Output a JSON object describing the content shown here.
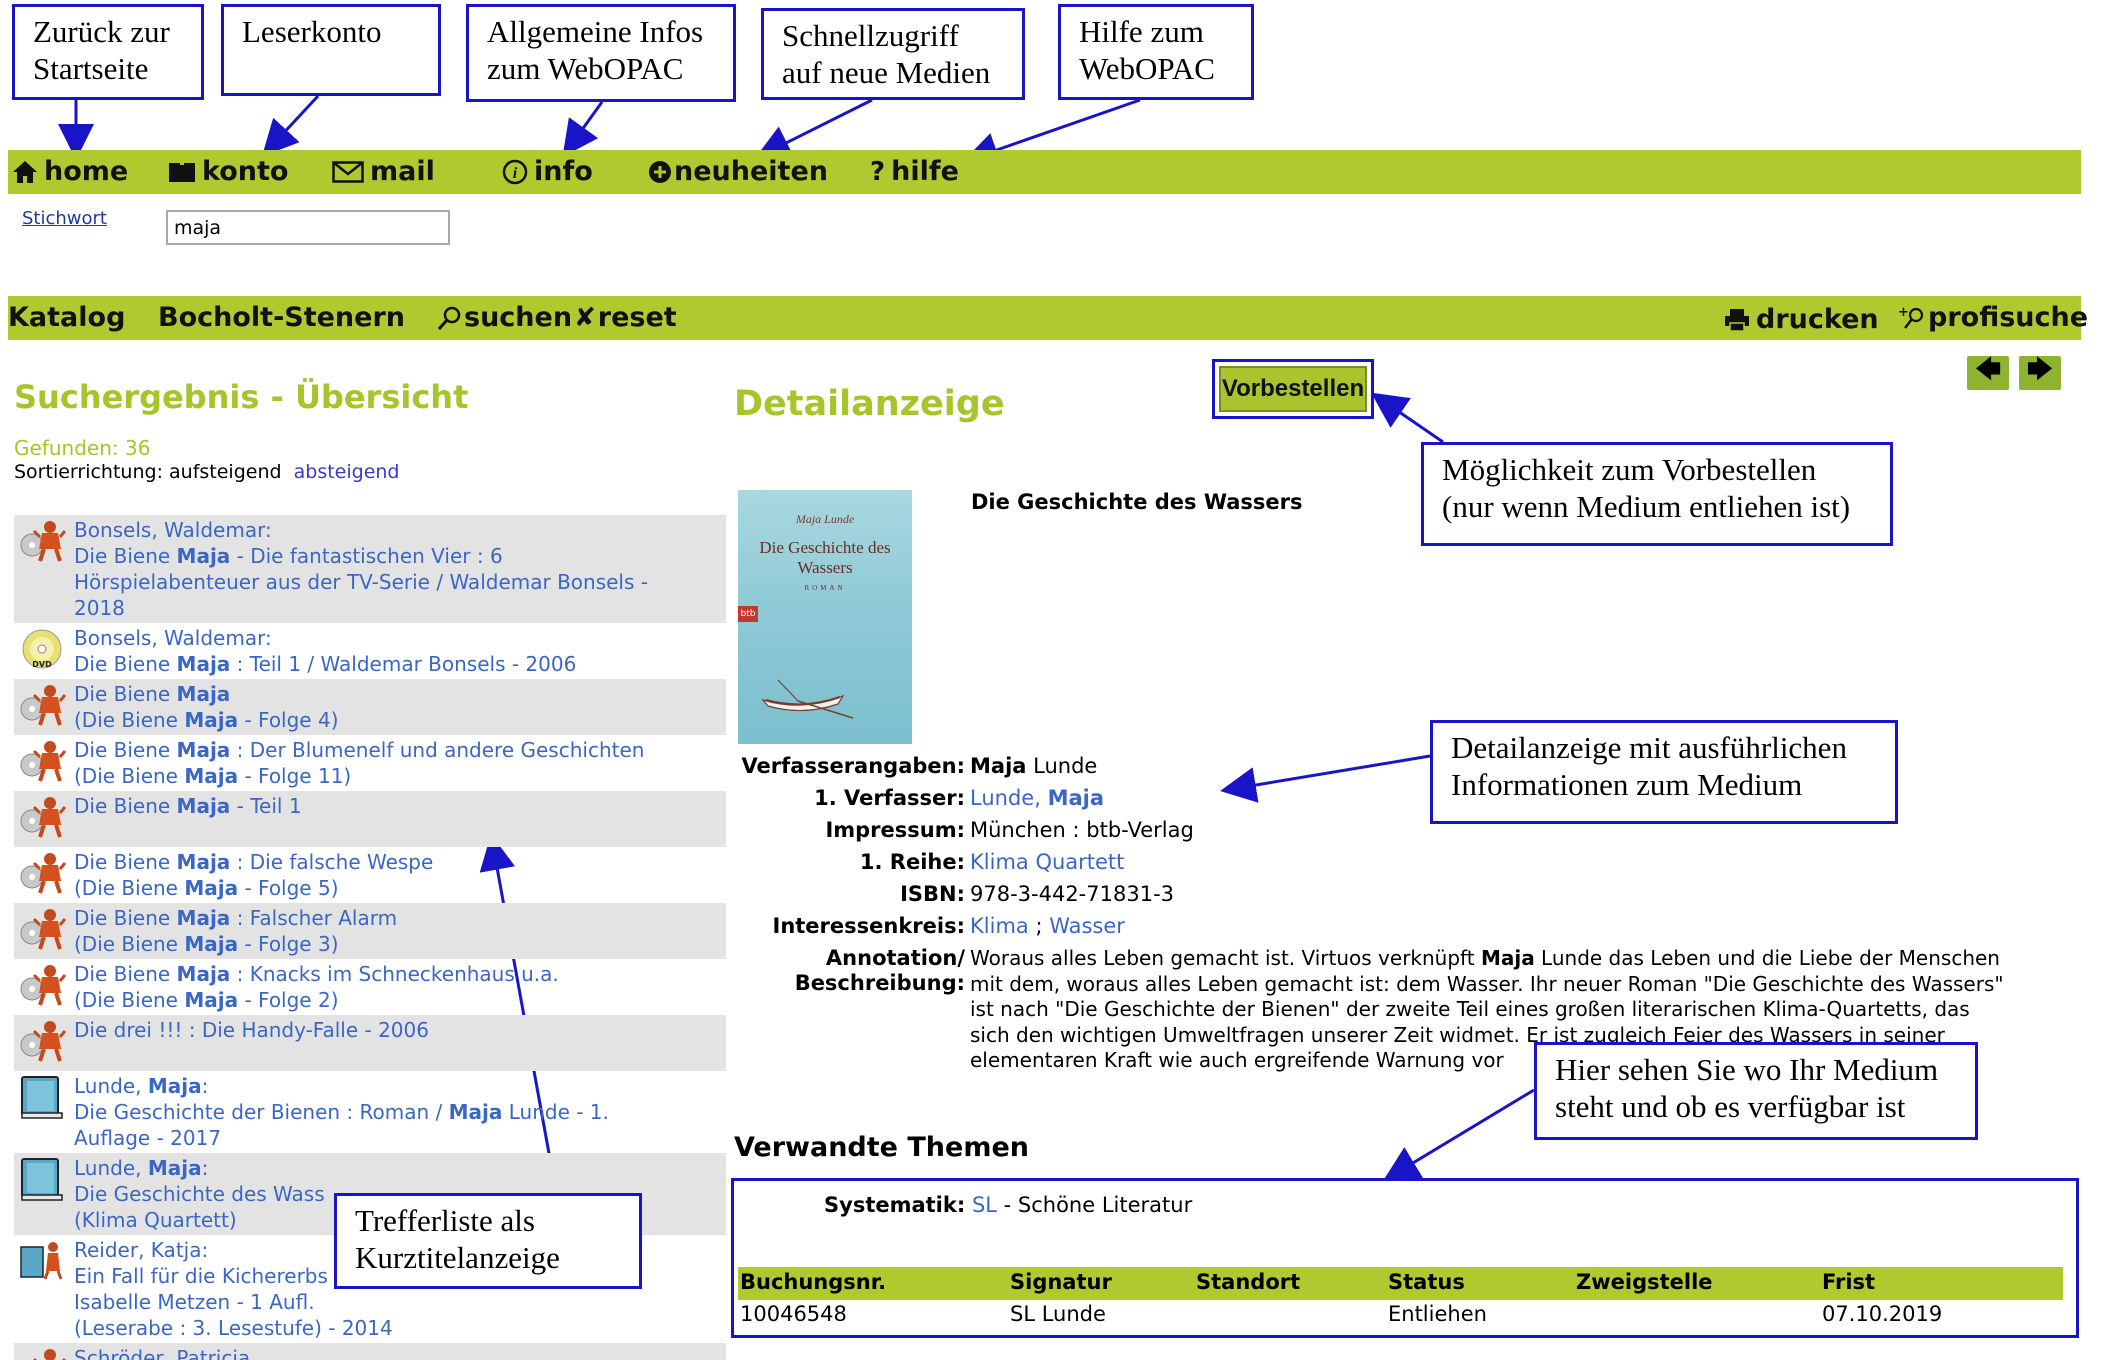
{
  "callouts": {
    "home": "Zurück zur\nStartseite",
    "konto": "Leserkonto",
    "info": "Allgemeine Infos\nzum WebOPAC",
    "neuheiten": "Schnellzugriff\nauf neue Medien",
    "hilfe": "Hilfe zum\nWebOPAC",
    "vorbestellen": "Möglichkeit zum Vorbestellen\n(nur wenn Medium entliehen ist)",
    "detail": "Detailanzeige mit ausführlichen\nInformationen zum Medium",
    "standort": "Hier sehen Sie wo Ihr Medium\nsteht und ob es verfügbar ist",
    "trefferliste": "Trefferliste als\nKurztitelanzeige"
  },
  "nav": {
    "home": "home",
    "konto": "konto",
    "mail": "mail",
    "info": "info",
    "neuheiten": "neuheiten",
    "hilfe": "hilfe"
  },
  "search": {
    "label": "Stichwort",
    "value": "maja"
  },
  "toolbar": {
    "katalog": "Katalog",
    "zweigstelle": "Bocholt-Stenern",
    "suchen": "suchen",
    "reset": "reset",
    "drucken": "drucken",
    "profisuche": "profisuche"
  },
  "results": {
    "heading": "Suchergebnis - Übersicht",
    "found": "Gefunden: 36",
    "sort_label": "Sortierrichtung:",
    "sort_asc": "aufsteigend",
    "sort_desc": "absteigend",
    "items": [
      {
        "icon": "audio",
        "html": "Bonsels, Waldemar:<br>Die Biene <b>Maja</b> - Die fantastischen Vier : 6<br>Hörspielabenteuer aus der TV-Serie / Waldemar Bonsels -<br>2018"
      },
      {
        "icon": "dvd",
        "html": "Bonsels, Waldemar:<br>Die Biene <b>Maja</b> : Teil 1 / Waldemar Bonsels - 2006"
      },
      {
        "icon": "audio",
        "html": "Die Biene <b>Maja</b><br>(Die Biene <b>Maja</b> - Folge 4)"
      },
      {
        "icon": "audio",
        "html": "Die Biene <b>Maja</b> : Der Blumenelf und andere Geschichten<br>(Die Biene <b>Maja</b> - Folge 11)"
      },
      {
        "icon": "audio",
        "html": "Die Biene <b>Maja</b> - Teil 1<br>&nbsp;"
      },
      {
        "icon": "audio",
        "html": "Die Biene <b>Maja</b> : Die falsche Wespe<br>(Die Biene <b>Maja</b> - Folge 5)"
      },
      {
        "icon": "audio",
        "html": "Die Biene <b>Maja</b> : Falscher Alarm<br>(Die Biene <b>Maja</b> - Folge 3)"
      },
      {
        "icon": "audio",
        "html": "Die Biene <b>Maja</b> : Knacks im Schneckenhaus u.a.<br>(Die Biene <b>Maja</b> - Folge 2)"
      },
      {
        "icon": "audio",
        "html": "Die drei !!! : Die Handy-Falle - 2006<br>&nbsp;"
      },
      {
        "icon": "book",
        "html": "Lunde, <b>Maja</b>:<br>Die Geschichte der Bienen : Roman / <b>Maja</b> Lunde - 1.<br>Auflage - 2017"
      },
      {
        "icon": "book",
        "html": "Lunde, <b>Maja</b>:<br>Die Geschichte des Wass<br>(Klima Quartett)"
      },
      {
        "icon": "bookaudio",
        "html": "Reider, Katja:<br>Ein Fall für die Kichererbs&nbsp;&nbsp;&nbsp;&nbsp;&nbsp;&nbsp;&nbsp;&nbsp;&nbsp;&nbsp;&nbsp;&nbsp;&nbsp;&nbsp;&nbsp;&nbsp;&nbsp;&nbsp;&nbsp;&nbsp;&nbsp;&nbsp;&nbsp;&nbsp;&nbsp;&nbsp;&nbsp;&nbsp;&nbsp;&nbsp;&nbsp;&nbsp;&nbsp;&nbsp;&nbsp;&nbsp;&nbsp;&nbsp;&nbsp;von<br>Isabelle Metzen - 1 Aufl.<br>(Leserabe : 3. Lesestufe) - 2014"
      },
      {
        "icon": "audio",
        "html": "Schröder, Patricia"
      }
    ]
  },
  "detail": {
    "heading": "Detailanzeige",
    "vorbestellen": "Vorbestellen",
    "title": "Die Geschichte des Wassers",
    "cover": {
      "author": "Maja Lunde",
      "title": "Die Geschichte des Wassers",
      "sub": "ROMAN",
      "publisher": "btb"
    },
    "fields": {
      "verfasserangaben_label": "Verfasserangaben:",
      "verfasserangaben_bold": "Maja",
      "verfasserangaben_rest": " Lunde",
      "verfasser_label": "1. Verfasser:",
      "verfasser_value_a": "Lunde, ",
      "verfasser_value_b": "Maja",
      "impressum_label": "Impressum:",
      "impressum_value": "München : btb-Verlag",
      "reihe_label": "1. Reihe:",
      "reihe_value": "Klima Quartett",
      "isbn_label": "ISBN:",
      "isbn_value": "978-3-442-71831-3",
      "interessenkreis_label": "Interessenkreis:",
      "interessenkreis_a": "Klima",
      "interessenkreis_sep": " ; ",
      "interessenkreis_b": "Wasser",
      "annotation_label1": "Annotation/",
      "annotation_label2": "Beschreibung:",
      "annotation_lines": [
        "Woraus alles Leben gemacht ist. Virtuos verknüpft <b>Maja</b> Lunde das Leben und die Liebe der Menschen",
        "mit dem, woraus alles Leben gemacht ist: dem Wasser. Ihr neuer Roman \"Die Geschichte des Wassers\"",
        "ist nach \"Die Geschichte der Bienen\" der zweite Teil eines großen literarischen Klima-Quartetts, das",
        "sich den wichtigen Umweltfragen unserer Zeit widmet. Er ist zugleich Feier des Wassers in seiner",
        "elementaren Kraft wie auch ergreifende Warnung vor"
      ]
    },
    "verwandte": "Verwandte Themen",
    "systematik_label": "Systematik:",
    "systematik_code": "SL",
    "systematik_text": " - Schöne Literatur"
  },
  "holdings": {
    "headers": [
      "Buchungsnr.",
      "Signatur",
      "Standort",
      "Status",
      "Zweigstelle",
      "Frist"
    ],
    "rows": [
      [
        "10046548",
        "SL Lunde",
        "",
        "Entliehen",
        "",
        "07.10.2019"
      ]
    ]
  },
  "colors": {
    "bar_green": "#b0c92f",
    "heading_green": "#a5c52a",
    "link_blue": "#3a67c6",
    "callout_blue": "#1a14c8"
  }
}
